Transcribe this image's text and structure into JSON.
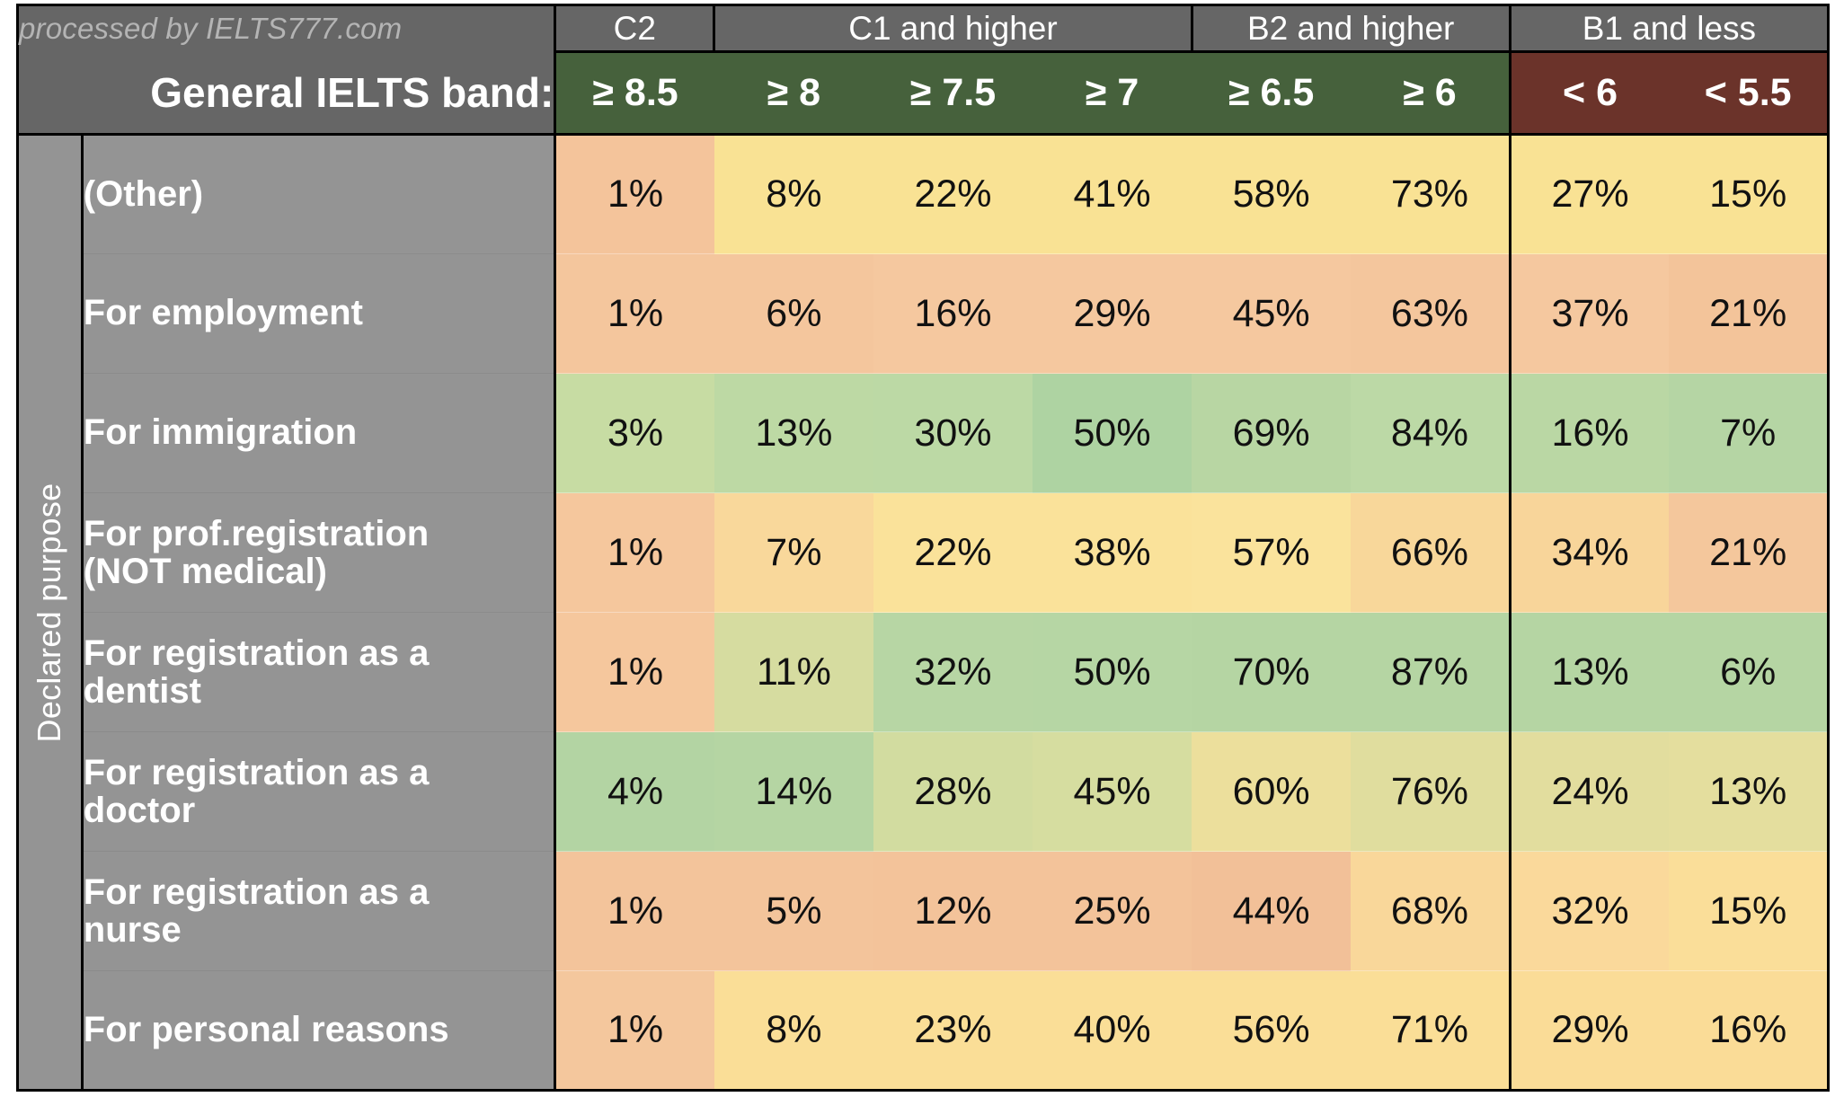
{
  "watermark": "processed by IELTS777.com",
  "title": "General IELTS band:",
  "row_axis_label": "Declared purpose",
  "band_groups": [
    {
      "label": "C2",
      "span": 1
    },
    {
      "label": "C1 and higher",
      "span": 3
    },
    {
      "label": "B2 and higher",
      "span": 2
    },
    {
      "label": "B1 and less",
      "span": 2
    }
  ],
  "columns": [
    {
      "label": "≥ 8.5",
      "kind": "good"
    },
    {
      "label": "≥ 8",
      "kind": "good"
    },
    {
      "label": "≥ 7.5",
      "kind": "good"
    },
    {
      "label": "≥ 7",
      "kind": "good"
    },
    {
      "label": "≥ 6.5",
      "kind": "good"
    },
    {
      "label": "≥ 6",
      "kind": "good"
    },
    {
      "label": "< 6",
      "kind": "bad"
    },
    {
      "label": "< 5.5",
      "kind": "bad"
    }
  ],
  "colors": {
    "header_gray": "#666666",
    "label_gray": "#949494",
    "band_good": "#46613c",
    "band_bad": "#6b332a",
    "border": "#000000",
    "heat_low": "#f2bd94",
    "heat_mid": "#f8e296",
    "heat_high": "#b3d6a0"
  },
  "chart_data": {
    "type": "heatmap",
    "title": "General IELTS band:",
    "xlabel": "General IELTS band",
    "ylabel": "Declared purpose",
    "categories": [
      "≥ 8.5",
      "≥ 8",
      "≥ 7.5",
      "≥ 7",
      "≥ 6.5",
      "≥ 6",
      "< 6",
      "< 5.5"
    ],
    "column_groups": [
      "C2",
      "C1 and higher",
      "C1 and higher",
      "C1 and higher",
      "B2 and higher",
      "B2 and higher",
      "B1 and less",
      "B1 and less"
    ],
    "rows": [
      "(Other)",
      "For employment",
      "For immigration",
      "For prof.registration (NOT medical)",
      "For registration as a dentist",
      "For registration as a doctor",
      "For registration as a nurse",
      "For personal reasons"
    ],
    "unit": "%",
    "values": [
      [
        1,
        8,
        22,
        41,
        58,
        73,
        27,
        15
      ],
      [
        1,
        6,
        16,
        29,
        45,
        63,
        37,
        21
      ],
      [
        3,
        13,
        30,
        50,
        69,
        84,
        16,
        7
      ],
      [
        1,
        7,
        22,
        38,
        57,
        66,
        34,
        21
      ],
      [
        1,
        11,
        32,
        50,
        70,
        87,
        13,
        6
      ],
      [
        4,
        14,
        28,
        45,
        60,
        76,
        24,
        13
      ],
      [
        1,
        5,
        12,
        25,
        44,
        68,
        32,
        15
      ],
      [
        1,
        8,
        23,
        40,
        56,
        71,
        29,
        16
      ]
    ]
  },
  "table": {
    "rows": [
      {
        "label_lines": [
          "(Other)"
        ],
        "cells": [
          {
            "text": "1%",
            "color": "#f4c49b"
          },
          {
            "text": "8%",
            "color": "#f9e294"
          },
          {
            "text": "22%",
            "color": "#f9e294"
          },
          {
            "text": "41%",
            "color": "#f9e294"
          },
          {
            "text": "58%",
            "color": "#f9e294"
          },
          {
            "text": "73%",
            "color": "#f9e294"
          },
          {
            "text": "27%",
            "color": "#f9e294"
          },
          {
            "text": "15%",
            "color": "#f9e294"
          }
        ]
      },
      {
        "label_lines": [
          "For employment"
        ],
        "cells": [
          {
            "text": "1%",
            "color": "#f4c69d"
          },
          {
            "text": "6%",
            "color": "#f4c69d"
          },
          {
            "text": "16%",
            "color": "#f5c89f"
          },
          {
            "text": "29%",
            "color": "#f5c89f"
          },
          {
            "text": "45%",
            "color": "#f5c89f"
          },
          {
            "text": "63%",
            "color": "#f4c69d"
          },
          {
            "text": "37%",
            "color": "#f5c89f"
          },
          {
            "text": "21%",
            "color": "#f3c49a"
          }
        ]
      },
      {
        "label_lines": [
          "For immigration"
        ],
        "cells": [
          {
            "text": "3%",
            "color": "#c7dca3"
          },
          {
            "text": "13%",
            "color": "#bdd9a4"
          },
          {
            "text": "30%",
            "color": "#bcd9a5"
          },
          {
            "text": "50%",
            "color": "#aed3a2"
          },
          {
            "text": "69%",
            "color": "#b8d6a3"
          },
          {
            "text": "84%",
            "color": "#bcd9a6"
          },
          {
            "text": "16%",
            "color": "#bad7a4"
          },
          {
            "text": "7%",
            "color": "#b5d5a4"
          }
        ]
      },
      {
        "label_lines": [
          "For prof.registration",
          "(NOT medical)"
        ],
        "cells": [
          {
            "text": "1%",
            "color": "#f5c79d"
          },
          {
            "text": "7%",
            "color": "#f9d89b"
          },
          {
            "text": "22%",
            "color": "#fae29a"
          },
          {
            "text": "38%",
            "color": "#fae29a"
          },
          {
            "text": "57%",
            "color": "#fae39c"
          },
          {
            "text": "66%",
            "color": "#f8d79a"
          },
          {
            "text": "34%",
            "color": "#f8d59a"
          },
          {
            "text": "21%",
            "color": "#f4c79c"
          }
        ]
      },
      {
        "label_lines": [
          "For registration as a",
          "dentist"
        ],
        "cells": [
          {
            "text": "1%",
            "color": "#f5c79d"
          },
          {
            "text": "11%",
            "color": "#d6dca0"
          },
          {
            "text": "32%",
            "color": "#b7d6a4"
          },
          {
            "text": "50%",
            "color": "#b6d6a4"
          },
          {
            "text": "70%",
            "color": "#b5d5a3"
          },
          {
            "text": "87%",
            "color": "#b5d5a3"
          },
          {
            "text": "13%",
            "color": "#b5d5a3"
          },
          {
            "text": "6%",
            "color": "#b5d5a3"
          }
        ]
      },
      {
        "label_lines": [
          "For registration as a",
          "doctor"
        ],
        "cells": [
          {
            "text": "4%",
            "color": "#b3d4a3"
          },
          {
            "text": "14%",
            "color": "#b5d5a3"
          },
          {
            "text": "28%",
            "color": "#d2dca0"
          },
          {
            "text": "45%",
            "color": "#d6dda0"
          },
          {
            "text": "60%",
            "color": "#ecdf9c"
          },
          {
            "text": "76%",
            "color": "#e0dd9e"
          },
          {
            "text": "24%",
            "color": "#e2dd9e"
          },
          {
            "text": "13%",
            "color": "#e4de9e"
          }
        ]
      },
      {
        "label_lines": [
          "For registration as a",
          "nurse"
        ],
        "cells": [
          {
            "text": "1%",
            "color": "#f3c49b"
          },
          {
            "text": "5%",
            "color": "#f3c49b"
          },
          {
            "text": "12%",
            "color": "#f3c39a"
          },
          {
            "text": "25%",
            "color": "#f3c39a"
          },
          {
            "text": "44%",
            "color": "#f2c098"
          },
          {
            "text": "68%",
            "color": "#f9d79a"
          },
          {
            "text": "32%",
            "color": "#fad99b"
          },
          {
            "text": "15%",
            "color": "#fade99"
          }
        ]
      },
      {
        "label_lines": [
          "For personal reasons"
        ],
        "cells": [
          {
            "text": "1%",
            "color": "#f4c79d"
          },
          {
            "text": "8%",
            "color": "#fade97"
          },
          {
            "text": "23%",
            "color": "#fade97"
          },
          {
            "text": "40%",
            "color": "#fade97"
          },
          {
            "text": "56%",
            "color": "#fade97"
          },
          {
            "text": "71%",
            "color": "#fade97"
          },
          {
            "text": "29%",
            "color": "#fadc97"
          },
          {
            "text": "16%",
            "color": "#fadc97"
          }
        ]
      }
    ]
  }
}
